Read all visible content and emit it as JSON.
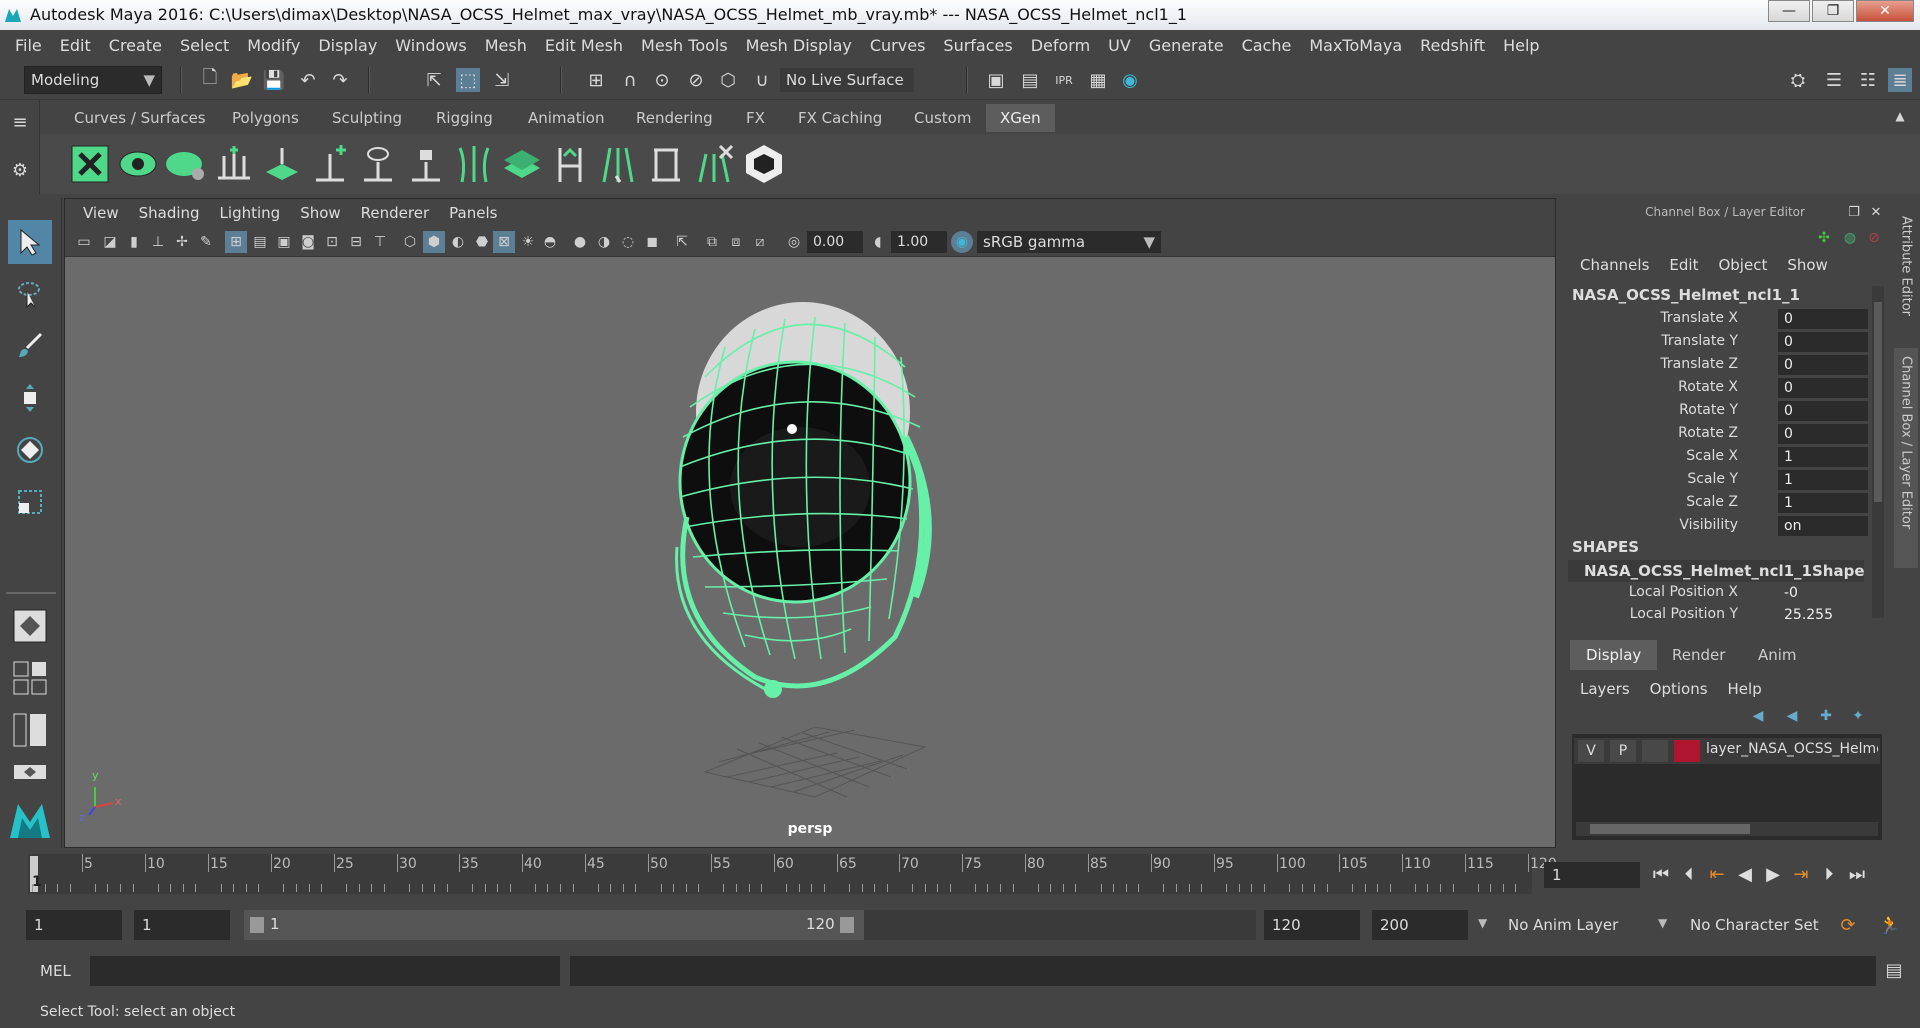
{
  "window": {
    "title": "Autodesk Maya 2016: C:\\Users\\dimax\\Desktop\\NASA_OCSS_Helmet_max_vray\\NASA_OCSS_Helmet_mb_vray.mb*   ---   NASA_OCSS_Helmet_ncl1_1",
    "min": "—",
    "max": "❐",
    "close": "✕"
  },
  "menubar": [
    "File",
    "Edit",
    "Create",
    "Select",
    "Modify",
    "Display",
    "Windows",
    "Mesh",
    "Edit Mesh",
    "Mesh Tools",
    "Mesh Display",
    "Curves",
    "Surfaces",
    "Deform",
    "UV",
    "Generate",
    "Cache",
    "MaxToMaya",
    "Redshift",
    "Help"
  ],
  "statusline": {
    "mode": "Modeling",
    "live_surface": "No Live Surface"
  },
  "shelf_tabs": [
    "Curves / Surfaces",
    "Polygons",
    "Sculpting",
    "Rigging",
    "Animation",
    "Rendering",
    "FX",
    "FX Caching",
    "Custom",
    "XGen"
  ],
  "shelf_active": "XGen",
  "panel_menu": [
    "View",
    "Shading",
    "Lighting",
    "Show",
    "Renderer",
    "Panels"
  ],
  "panel_fields": {
    "exposure": "0.00",
    "gamma": "1.00",
    "color_space": "sRGB gamma"
  },
  "viewport": {
    "camera": "persp",
    "axis_x": "x",
    "axis_y": "y",
    "axis_z": "z"
  },
  "channel_box": {
    "title": "Channel Box / Layer Editor",
    "menu": [
      "Channels",
      "Edit",
      "Object",
      "Show"
    ],
    "object": "NASA_OCSS_Helmet_ncl1_1",
    "attributes": [
      {
        "label": "Translate X",
        "value": "0"
      },
      {
        "label": "Translate Y",
        "value": "0"
      },
      {
        "label": "Translate Z",
        "value": "0"
      },
      {
        "label": "Rotate X",
        "value": "0"
      },
      {
        "label": "Rotate Y",
        "value": "0"
      },
      {
        "label": "Rotate Z",
        "value": "0"
      },
      {
        "label": "Scale X",
        "value": "1"
      },
      {
        "label": "Scale Y",
        "value": "1"
      },
      {
        "label": "Scale Z",
        "value": "1"
      },
      {
        "label": "Visibility",
        "value": "on"
      }
    ],
    "shapes_heading": "SHAPES",
    "shape_name": "NASA_OCSS_Helmet_ncl1_1Shape",
    "shape_attributes": [
      {
        "label": "Local Position X",
        "value": "-0"
      },
      {
        "label": "Local Position Y",
        "value": "25.255"
      }
    ]
  },
  "side_tabs": [
    "Attribute Editor",
    "Channel Box / Layer Editor"
  ],
  "layer_editor": {
    "tabs": [
      "Display",
      "Render",
      "Anim"
    ],
    "menu": [
      "Layers",
      "Options",
      "Help"
    ],
    "layer": {
      "v": "V",
      "p": "P",
      "name": "layer_NASA_OCSS_Helmet",
      "color": "#b01530"
    }
  },
  "timeline": {
    "ticks": [
      "5",
      "10",
      "15",
      "20",
      "25",
      "30",
      "35",
      "40",
      "45",
      "50",
      "55",
      "60",
      "65",
      "70",
      "75",
      "80",
      "85",
      "90",
      "95",
      "100",
      "105",
      "110",
      "115",
      "120"
    ],
    "start_label": "1",
    "current_frame": "1"
  },
  "range": {
    "start": "1",
    "inner_start": "1",
    "slider_start": "1",
    "slider_end": "120",
    "end": "120",
    "max": "200",
    "anim_layer": "No Anim Layer",
    "character_set": "No Character Set"
  },
  "cmd": {
    "lang": "MEL"
  },
  "help": "Select Tool: select an object",
  "colors": {
    "accent": "#5285a6",
    "wire": "#66f0a8",
    "bg": "#444444"
  }
}
